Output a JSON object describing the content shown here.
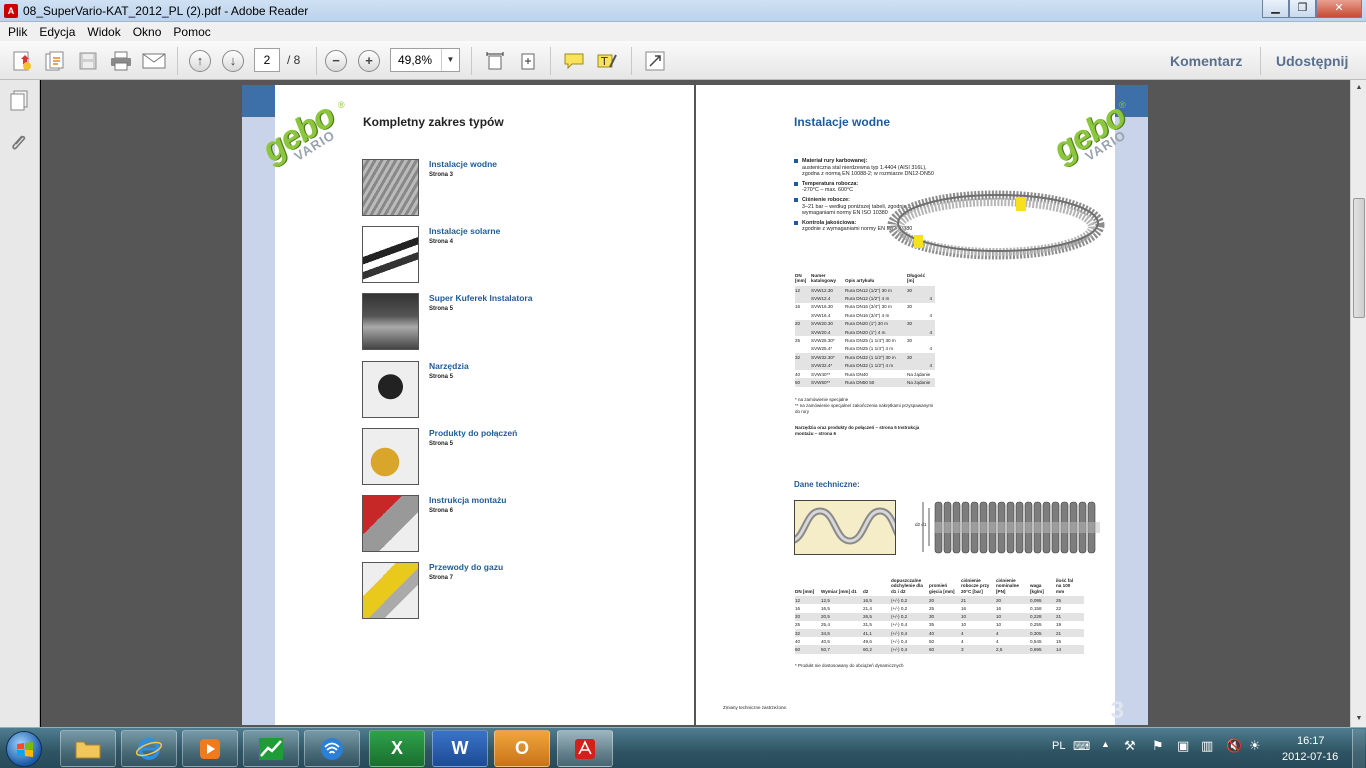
{
  "window": {
    "title": "08_SuperVario-KAT_2012_PL (2).pdf - Adobe Reader",
    "minimize": "▁",
    "restore": "❐",
    "close": "✕"
  },
  "menu": [
    "Plik",
    "Edycja",
    "Widok",
    "Okno",
    "Pomoc"
  ],
  "toolbar": {
    "page_current": "2",
    "page_total": "/ 8",
    "zoom": "49,8%",
    "comment_label": "Komentarz",
    "share_label": "Udostępnij"
  },
  "left_page": {
    "logo_text": "gebo",
    "logo_sub": "VARIO",
    "heading": "Kompletny zakres typów",
    "items": [
      {
        "title": "Instalacje wodne",
        "page": "Strona 3"
      },
      {
        "title": "Instalacje solarne",
        "page": "Strona 4"
      },
      {
        "title": "Super Kuferek Instalatora",
        "page": "Strona 5"
      },
      {
        "title": "Narzędzia",
        "page": "Strona 5"
      },
      {
        "title": "Produkty do połączeń",
        "page": "Strona 5"
      },
      {
        "title": "Instrukcja montażu",
        "page": "Strona 6"
      },
      {
        "title": "Przewody do gazu",
        "page": "Strona 7"
      }
    ]
  },
  "right_page": {
    "heading": "Instalacje wodne",
    "logo_text": "gebo",
    "logo_sub": "VARIO",
    "bullets": [
      {
        "title": "Materiał rury karbowanej:",
        "text": "austeniczna stal nierdzewna typ 1.4404 (AISI 316L), zgodna z normą EN 10088-2; w rozmiarze DN12-DN50"
      },
      {
        "title": "Temperatura robocza:",
        "text": "-270°C – max. 600°C"
      },
      {
        "title": "Ciśnienie robocze:",
        "text": "3–21 bar – według poniższej tabeli, zgodnie z wymaganiami normy EN ISO 10380"
      },
      {
        "title": "Kontrola jakościowa:",
        "text": "zgodnie z wymaganiami normy EN ISO 10380"
      }
    ],
    "table1": {
      "headers": [
        "DN [mm]",
        "Numer katalogowy",
        "Opis artykułu",
        "Długość [m]"
      ],
      "rows": [
        [
          "12",
          "SVW12.30",
          "Rura DN12 (1/2\") 30 m",
          "30"
        ],
        [
          "",
          "SVW12.4",
          "Rura DN12 (1/2\") 4 m",
          "4"
        ],
        [
          "16",
          "SVW16.30",
          "Rura DN16 (3/4\") 30 m",
          "30"
        ],
        [
          "",
          "SVW16.4",
          "Rura DN16 (3/4\") 4 m",
          "4"
        ],
        [
          "20",
          "SVW20.30",
          "Rura DN20 (1\") 30 m",
          "30"
        ],
        [
          "",
          "SVW20.4",
          "Rura DN20 (1\") 4 m",
          "4"
        ],
        [
          "25",
          "SVW25.30*",
          "Rura DN25 (1 1/4\") 30 m",
          "30"
        ],
        [
          "",
          "SVW25.4*",
          "Rura DN25 (1 1/4\") 4 m",
          "4"
        ],
        [
          "32",
          "SVW32.30*",
          "Rura DN32 (1 1/2\") 30 m",
          "30"
        ],
        [
          "",
          "SVW32.4*",
          "Rura DN32 (1 1/2\") 4 m",
          "4"
        ],
        [
          "40",
          "SVW40**",
          "Rura DN40",
          "Na żądanie"
        ],
        [
          "50",
          "SVW50**",
          "Rura DN50 50",
          "Na żądanie"
        ]
      ]
    },
    "footnote1": "* na zamówienie specjalne",
    "footnote2": "** na zamówienie specjalne/ zakończenia nakrętkami przyspawanymi do rury",
    "ref_note": "Narzędzia oraz produkty do połączeń – strona 5 Instrukcja montażu – strona 6",
    "tech_heading": "Dane techniczne:",
    "dim_label": "d2 d1",
    "table2": {
      "headers": [
        "DN [mm]",
        "Wymiar [mm] d1",
        "d2",
        "dopuszczalne odchylenie dla d1 i d2",
        "promień gięcia [mm]",
        "ciśnienie robocze przy 20°C [bar]",
        "ciśnienie nominalne [PN]",
        "waga [kg/m]",
        "ilość fal na 100 mm"
      ],
      "rows": [
        [
          "12",
          "12,5",
          "16,5",
          "(+/-) 0,2",
          "20",
          "21",
          "20",
          "0,095",
          "25"
        ],
        [
          "16",
          "16,5",
          "21,4",
          "(+/-) 0,2",
          "25",
          "16",
          "16",
          "0,158",
          "22"
        ],
        [
          "20",
          "20,5",
          "26,5",
          "(+/-) 0,2",
          "30",
          "10",
          "10",
          "0,228",
          "21"
        ],
        [
          "25",
          "25,4",
          "31,5",
          "(+/-) 0,4",
          "35",
          "10",
          "10",
          "0,255",
          "19"
        ],
        [
          "32",
          "34,5",
          "41,1",
          "(+/-) 0,4",
          "40",
          "4",
          "4",
          "0,305",
          "21"
        ],
        [
          "40",
          "40,5",
          "49,6",
          "(+/-) 0,4",
          "50",
          "4",
          "4",
          "0,545",
          "15"
        ],
        [
          "50",
          "50,7",
          "60,2",
          "(+/-) 0,4",
          "60",
          "3",
          "2,5",
          "0,695",
          "14"
        ]
      ]
    },
    "footnote3": "* Produkt nie dostosowany do obciążeń dynamicznych",
    "bottom_note": "Zmiany techniczne zastrzeżone.",
    "page_number": "3"
  },
  "taskbar": {
    "apps": [
      "explorer",
      "internet-explorer",
      "media-player",
      "chart-app",
      "wifi-app",
      "excel",
      "word",
      "outlook",
      "adobe-reader"
    ],
    "excel_letter": "X",
    "word_letter": "W",
    "outlook_letter": "O",
    "lang": "PL",
    "time": "16:17",
    "date": "2012-07-16"
  }
}
